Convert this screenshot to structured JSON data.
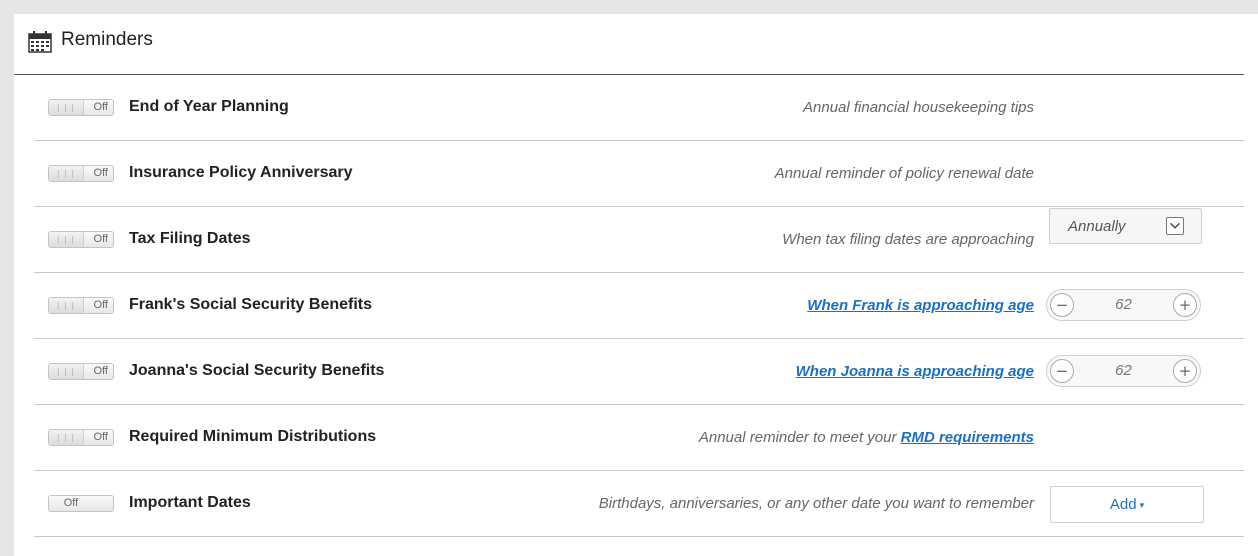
{
  "header": {
    "title": "Reminders",
    "icon": "calendar-icon"
  },
  "toggle_grip": "| | |",
  "rows": [
    {
      "state": "Off",
      "title": "End of Year Planning",
      "desc": "Annual financial housekeeping tips"
    },
    {
      "state": "Off",
      "title": "Insurance Policy Anniversary",
      "desc": "Annual reminder of policy renewal date"
    },
    {
      "state": "Off",
      "title": "Tax Filing Dates",
      "desc": "When tax filing dates are approaching",
      "control": {
        "selected": "Annually"
      }
    },
    {
      "state": "Off",
      "title": "Frank's Social Security Benefits",
      "desc_link": "When Frank is approaching age",
      "control": {
        "age": "62",
        "minus": "−",
        "plus": "+"
      }
    },
    {
      "state": "Off",
      "title": "Joanna's Social Security Benefits",
      "desc_link": "When Joanna is approaching age",
      "control": {
        "age": "62",
        "minus": "−",
        "plus": "+"
      }
    },
    {
      "state": "Off",
      "title": "Required Minimum Distributions",
      "desc_prefix": "Annual reminder to meet your ",
      "desc_link": "RMD requirements"
    },
    {
      "state": "Off",
      "title": "Important Dates",
      "desc": "Birthdays, anniversaries, or any other date you want to remember",
      "control": {
        "add_label": "Add",
        "caret": "▾"
      }
    }
  ],
  "colors": {
    "link": "#1a6fc9",
    "text": "#222222",
    "muted": "#666666"
  }
}
